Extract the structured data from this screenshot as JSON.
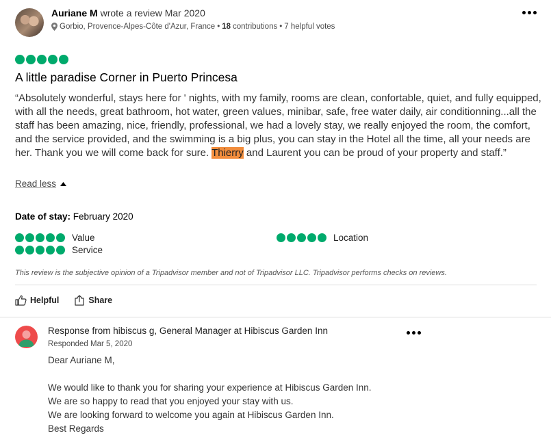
{
  "review": {
    "author": "Auriane M",
    "wrote_text": "wrote a review Mar 2020",
    "location": "Gorbio, Provence-Alpes-Côte d'Azur, France",
    "separator": "•",
    "contributions_count": "18",
    "contributions_label": "contributions",
    "helpful_votes": "7 helpful votes",
    "rating_bubbles": 5,
    "title": "A little paradise Corner in Puerto Princesa",
    "body_before": "“Absolutely wonderful, stays here for ' nights, with my family, rooms are clean, confortable, quiet, and fully equipped, with all the needs, great bathroom, hot water, green values, minibar, safe, free water daily, air conditionning...all the staff has been amazing, nice, friendly, professional, we had a lovely stay, we really enjoyed the room, the comfort, and the service provided, and the swimming is a big plus, you can stay in the Hotel all the time, all your needs are her. Thank you we will come back for sure. ",
    "body_highlight": "Thierry",
    "body_after": " and Laurent you can be proud of your property and staff.”",
    "read_less": "Read less",
    "date_of_stay_label": "Date of stay:",
    "date_of_stay_value": "February 2020",
    "subratings": [
      {
        "label": "Value",
        "bubbles": 5
      },
      {
        "label": "Location",
        "bubbles": 5
      },
      {
        "label": "Service",
        "bubbles": 5
      }
    ],
    "disclaimer": "This review is the subjective opinion of a Tripadvisor member and not of Tripadvisor LLC. Tripadvisor performs checks on reviews.",
    "helpful_label": "Helpful",
    "share_label": "Share"
  },
  "response": {
    "header": "Response from hibiscus g, General Manager at Hibiscus Garden Inn",
    "date": "Responded Mar 5, 2020",
    "body": "Dear Auriane M,\n\nWe would like to thank you for sharing your experience at Hibiscus Garden Inn.\nWe are so happy to read that you enjoyed your stay with us.\nWe are looking forward to welcome you again at Hibiscus Garden Inn.\nBest Regards"
  },
  "colors": {
    "bubble_green": "#00aa6c",
    "highlight_orange": "#f28d3c",
    "response_avatar_red": "#ee4b4b"
  }
}
